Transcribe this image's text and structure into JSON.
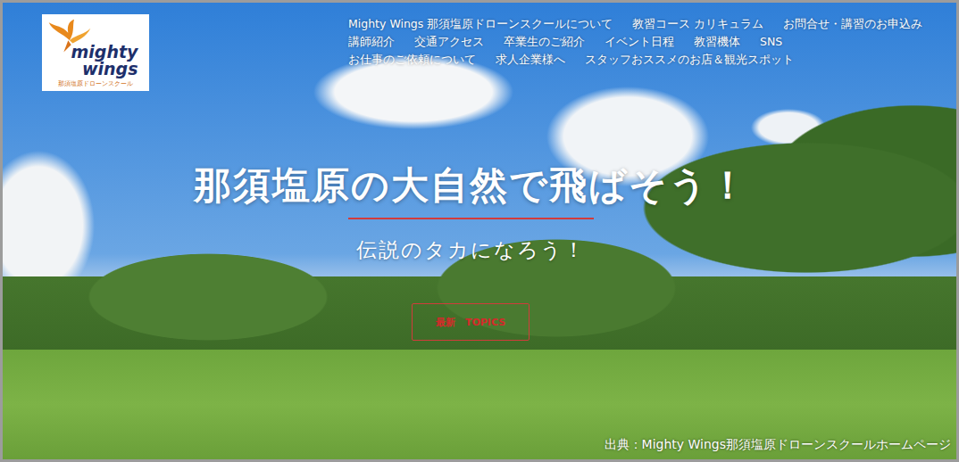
{
  "logo": {
    "wordmark_top": "mighty",
    "wordmark_bottom": "wings",
    "tagline": "那須塩原ドローンスクール"
  },
  "nav": {
    "rows": [
      [
        "Mighty Wings 那須塩原ドローンスクールについて",
        "教習コース カリキュラム",
        "お問合せ・講習のお申込み"
      ],
      [
        "講師紹介",
        "交通アクセス",
        "卒業生のご紹介",
        "イベント日程",
        "教習機体",
        "SNS"
      ],
      [
        "お仕事のご依頼について",
        "求人企業様へ",
        "スタッフおススメのお店＆観光スポット"
      ]
    ]
  },
  "hero": {
    "title": "那須塩原の大自然で飛ばそう！",
    "subtitle": "伝説のタカになろう！",
    "button": "最新　TOPICS"
  },
  "caption": "出典：Mighty Wings那須塩原ドローンスクールホームページ"
}
